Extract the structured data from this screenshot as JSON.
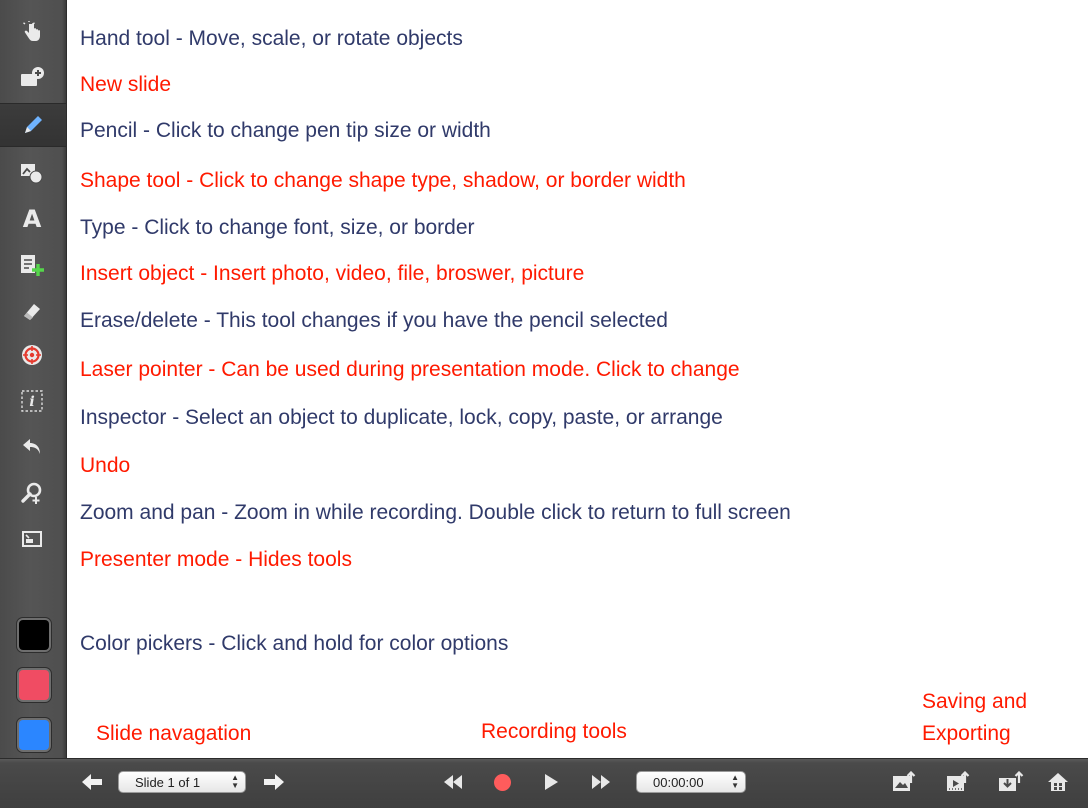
{
  "legend": [
    {
      "text": "Hand tool - Move, scale, or rotate objects",
      "color": "navy"
    },
    {
      "text": "New slide",
      "color": "red"
    },
    {
      "text": "Pencil - Click to change pen tip size or width",
      "color": "navy"
    },
    {
      "text": "Shape tool - Click to change shape type, shadow, or border width",
      "color": "red"
    },
    {
      "text": "Type - Click to change font, size, or border",
      "color": "navy"
    },
    {
      "text": "Insert object - Insert photo, video, file, broswer, picture",
      "color": "red"
    },
    {
      "text": "Erase/delete - This tool changes if you have the pencil selected",
      "color": "navy"
    },
    {
      "text": "Laser pointer - Can be used during presentation mode. Click to change",
      "color": "red"
    },
    {
      "text": "Inspector - Select an object to duplicate, lock, copy, paste, or arrange",
      "color": "navy"
    },
    {
      "text": "Undo",
      "color": "red"
    },
    {
      "text": "Zoom and pan - Zoom in while recording. Double click to return to full screen",
      "color": "navy"
    },
    {
      "text": "Presenter mode - Hides tools",
      "color": "red"
    },
    {
      "text": "Color pickers - Click and hold for color options",
      "color": "navy"
    }
  ],
  "captions": {
    "slide_navigation": "Slide navagation",
    "recording_tools": "Recording tools",
    "saving_line1": "Saving and",
    "saving_line2": "Exporting"
  },
  "toolbar": {
    "tools": [
      "hand-icon",
      "new-slide-icon",
      "pencil-icon",
      "shape-icon",
      "type-icon",
      "insert-object-icon",
      "eraser-icon",
      "laser-pointer-icon",
      "inspector-icon",
      "undo-icon",
      "zoom-icon",
      "presenter-mode-icon"
    ],
    "active_tool": "pencil-icon",
    "type_glyph": "A",
    "inspector_glyph": "i",
    "swatches": [
      "#000000",
      "#f04c63",
      "#2b86ff"
    ]
  },
  "bottombar": {
    "slide_selector": "Slide 1 of 1",
    "timer": "00:00:00"
  },
  "colors": {
    "navy": "#303a6a",
    "red": "#ff1a00",
    "toolbar_bg": "#4f4f4f",
    "record_red": "#ff5c5c"
  }
}
